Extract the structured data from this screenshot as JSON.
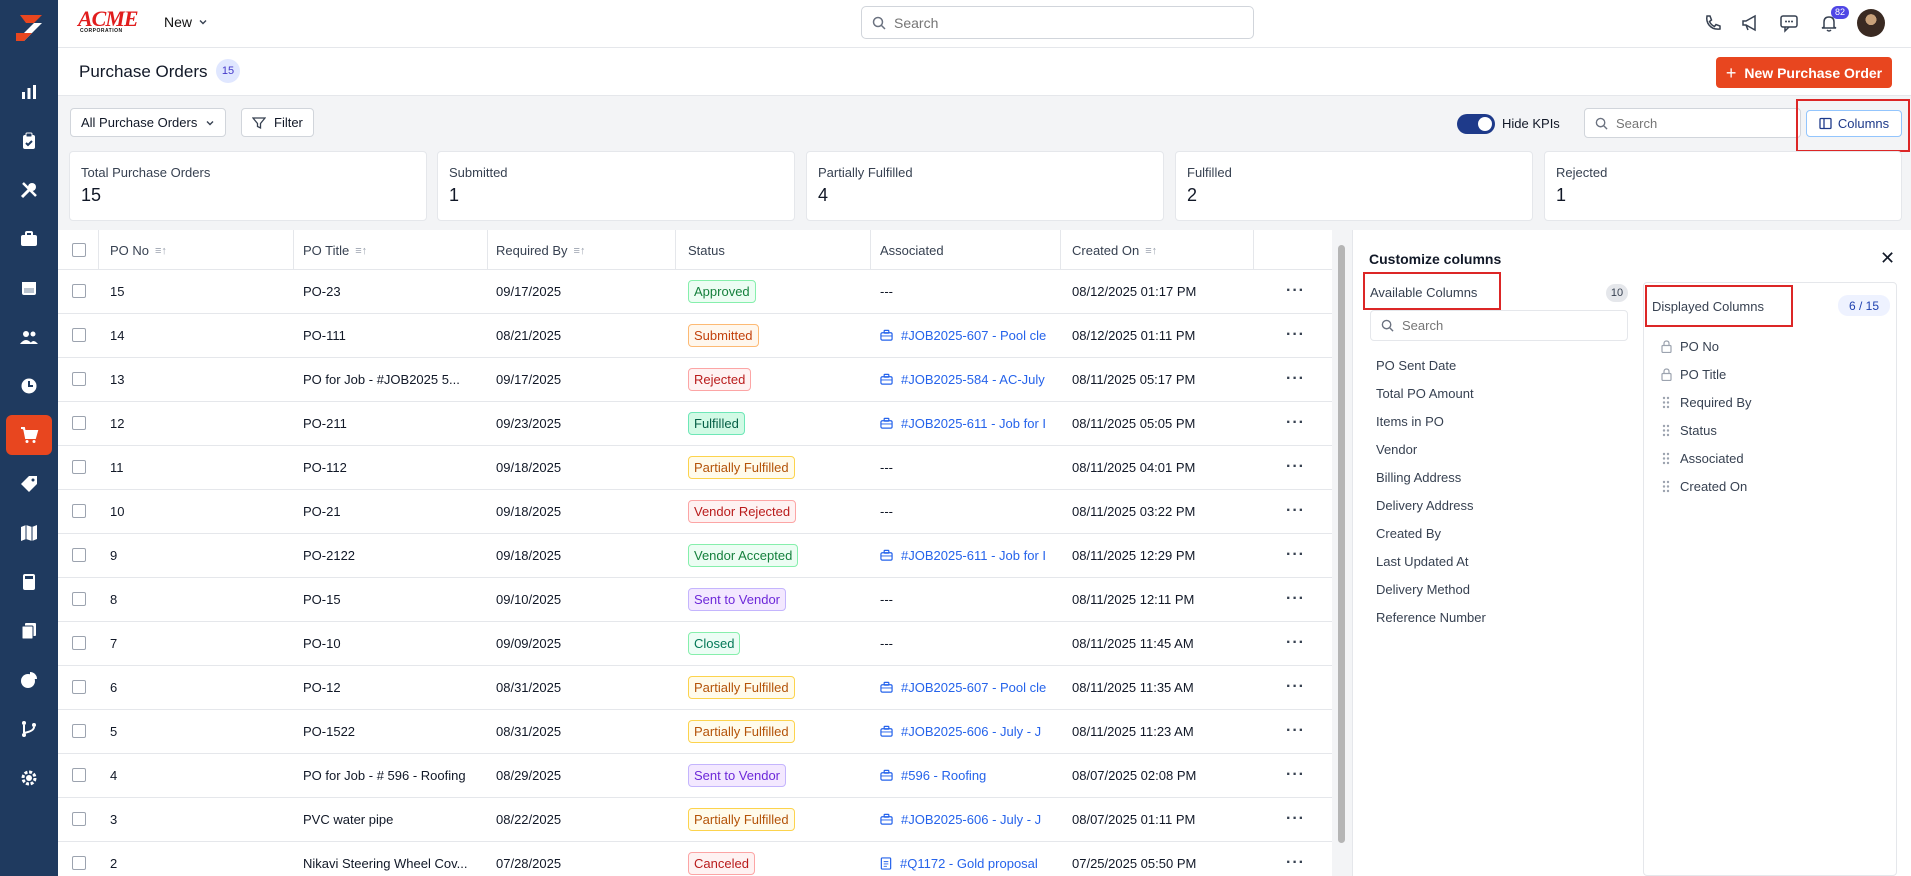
{
  "brand": {
    "logo_text": "ACME",
    "logo_sub": "CORPORATION",
    "accent": "#e8461f",
    "sidebar_bg": "#1f3a5f"
  },
  "topbar": {
    "new_label": "New",
    "search_placeholder": "Search",
    "notification_count": "82"
  },
  "header": {
    "title": "Purchase Orders",
    "count": "15",
    "new_button": "New Purchase Order"
  },
  "filters": {
    "view_label": "All Purchase Orders",
    "filter_label": "Filter",
    "hide_kpis_label": "Hide KPIs",
    "search_placeholder": "Search",
    "columns_label": "Columns"
  },
  "kpis": [
    {
      "label": "Total Purchase Orders",
      "value": "15"
    },
    {
      "label": "Submitted",
      "value": "1"
    },
    {
      "label": "Partially Fulfilled",
      "value": "4"
    },
    {
      "label": "Fulfilled",
      "value": "2"
    },
    {
      "label": "Rejected",
      "value": "1"
    }
  ],
  "table": {
    "headers": [
      "PO No",
      "PO Title",
      "Required By",
      "Status",
      "Associated",
      "Created On"
    ],
    "rows": [
      {
        "no": "15",
        "title": "PO-23",
        "required": "09/17/2025",
        "status": "Approved",
        "assoc": "---",
        "assoc_icon": "",
        "created": "08/12/2025 01:17 PM"
      },
      {
        "no": "14",
        "title": "PO-111",
        "required": "08/21/2025",
        "status": "Submitted",
        "assoc": "#JOB2025-607 - Pool cle",
        "assoc_icon": "job",
        "created": "08/12/2025 01:11 PM"
      },
      {
        "no": "13",
        "title": "PO for Job - #JOB2025 5...",
        "required": "09/17/2025",
        "status": "Rejected",
        "assoc": "#JOB2025-584 - AC-July",
        "assoc_icon": "job",
        "created": "08/11/2025 05:17 PM"
      },
      {
        "no": "12",
        "title": "PO-211",
        "required": "09/23/2025",
        "status": "Fulfilled",
        "assoc": "#JOB2025-611 - Job for I",
        "assoc_icon": "job",
        "created": "08/11/2025 05:05 PM"
      },
      {
        "no": "11",
        "title": "PO-112",
        "required": "09/18/2025",
        "status": "Partially Fulfilled",
        "assoc": "---",
        "assoc_icon": "",
        "created": "08/11/2025 04:01 PM"
      },
      {
        "no": "10",
        "title": "PO-21",
        "required": "09/18/2025",
        "status": "Vendor Rejected",
        "assoc": "---",
        "assoc_icon": "",
        "created": "08/11/2025 03:22 PM"
      },
      {
        "no": "9",
        "title": "PO-2122",
        "required": "09/18/2025",
        "status": "Vendor Accepted",
        "assoc": "#JOB2025-611 - Job for I",
        "assoc_icon": "job",
        "created": "08/11/2025 12:29 PM"
      },
      {
        "no": "8",
        "title": "PO-15",
        "required": "09/10/2025",
        "status": "Sent to Vendor",
        "assoc": "---",
        "assoc_icon": "",
        "created": "08/11/2025 12:11 PM"
      },
      {
        "no": "7",
        "title": "PO-10",
        "required": "09/09/2025",
        "status": "Closed",
        "assoc": "---",
        "assoc_icon": "",
        "created": "08/11/2025 11:45 AM"
      },
      {
        "no": "6",
        "title": "PO-12",
        "required": "08/31/2025",
        "status": "Partially Fulfilled",
        "assoc": "#JOB2025-607 - Pool cle",
        "assoc_icon": "job",
        "created": "08/11/2025 11:35 AM"
      },
      {
        "no": "5",
        "title": "PO-1522",
        "required": "08/31/2025",
        "status": "Partially Fulfilled",
        "assoc": "#JOB2025-606 - July - J",
        "assoc_icon": "job",
        "created": "08/11/2025 11:23 AM"
      },
      {
        "no": "4",
        "title": "PO for Job - # 596 - Roofing",
        "required": "08/29/2025",
        "status": "Sent to Vendor",
        "assoc": "#596 - Roofing",
        "assoc_icon": "job",
        "created": "08/07/2025 02:08 PM"
      },
      {
        "no": "3",
        "title": "PVC water pipe",
        "required": "08/22/2025",
        "status": "Partially Fulfilled",
        "assoc": "#JOB2025-606 - July - J",
        "assoc_icon": "job",
        "created": "08/07/2025 01:11 PM"
      },
      {
        "no": "2",
        "title": "Nikavi Steering Wheel Cov...",
        "required": "07/28/2025",
        "status": "Canceled",
        "assoc": "#Q1172 - Gold proposal",
        "assoc_icon": "quote",
        "created": "07/25/2025 05:50 PM"
      }
    ]
  },
  "status_colors": {
    "Approved": [
      "#ecfdf3",
      "#86efac",
      "#15803d"
    ],
    "Submitted": [
      "#fff7ed",
      "#fdba74",
      "#c2410c"
    ],
    "Rejected": [
      "#fef2f2",
      "#fca5a5",
      "#b91c1c"
    ],
    "Fulfilled": [
      "#d1fae5",
      "#6ee7b7",
      "#065f46"
    ],
    "Partially Fulfilled": [
      "#fffbeb",
      "#fcd34d",
      "#b45309"
    ],
    "Vendor Rejected": [
      "#fef2f2",
      "#fca5a5",
      "#b91c1c"
    ],
    "Vendor Accepted": [
      "#ecfdf3",
      "#86efac",
      "#15803d"
    ],
    "Sent to Vendor": [
      "#f3e8ff",
      "#c4b5fd",
      "#6d28d9"
    ],
    "Closed": [
      "#ecfdf5",
      "#86efac",
      "#047857"
    ],
    "Canceled": [
      "#fef2f2",
      "#fca5a5",
      "#b91c1c"
    ]
  },
  "customize": {
    "title": "Customize columns",
    "available_title": "Available Columns",
    "available_count": "10",
    "available_search_placeholder": "Search",
    "available": [
      "PO Sent Date",
      "Total PO Amount",
      "Items in PO",
      "Vendor",
      "Billing Address",
      "Delivery Address",
      "Created By",
      "Last Updated At",
      "Delivery Method",
      "Reference Number"
    ],
    "displayed_title": "Displayed Columns",
    "displayed_count": "6 / 15",
    "displayed": [
      {
        "label": "PO No",
        "locked": true
      },
      {
        "label": "PO Title",
        "locked": true
      },
      {
        "label": "Required By",
        "locked": false
      },
      {
        "label": "Status",
        "locked": false
      },
      {
        "label": "Associated",
        "locked": false
      },
      {
        "label": "Created On",
        "locked": false
      }
    ]
  }
}
